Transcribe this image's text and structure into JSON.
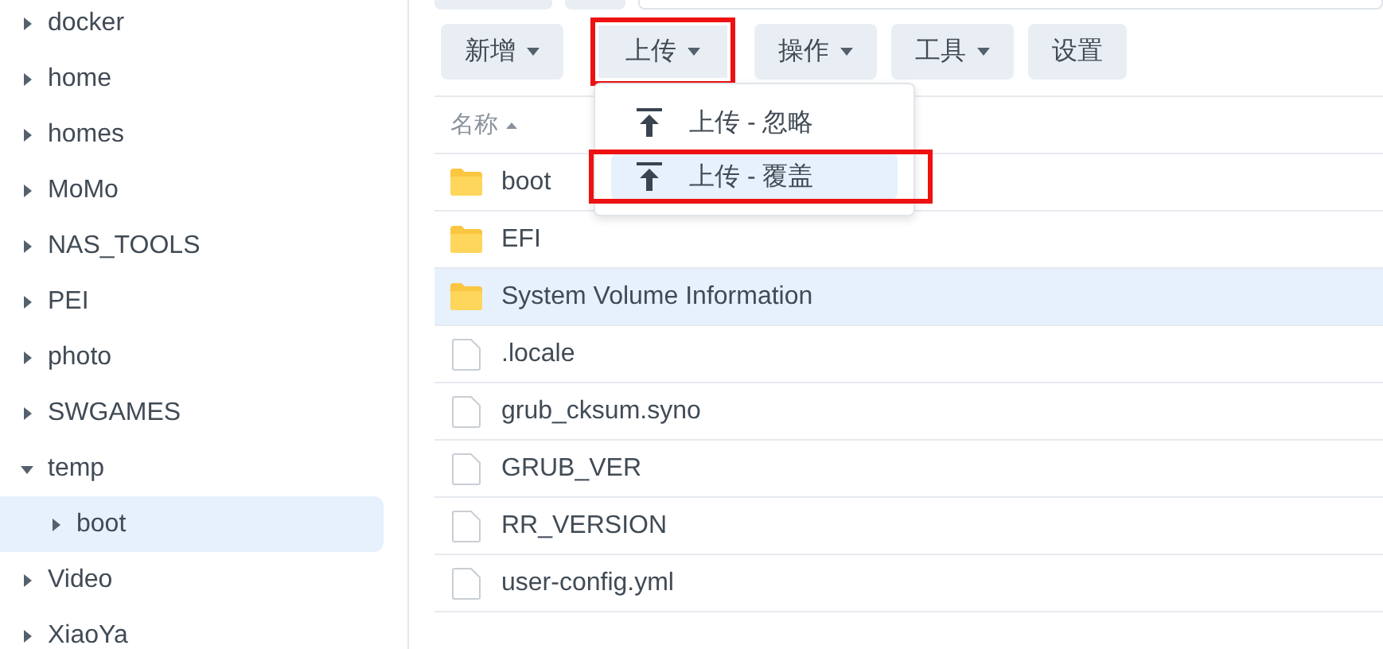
{
  "sidebar": {
    "items": [
      {
        "label": "docker",
        "expanded": false,
        "selected": false
      },
      {
        "label": "home",
        "expanded": false,
        "selected": false
      },
      {
        "label": "homes",
        "expanded": false,
        "selected": false
      },
      {
        "label": "MoMo",
        "expanded": false,
        "selected": false
      },
      {
        "label": "NAS_TOOLS",
        "expanded": false,
        "selected": false
      },
      {
        "label": "PEI",
        "expanded": false,
        "selected": false
      },
      {
        "label": "photo",
        "expanded": false,
        "selected": false
      },
      {
        "label": "SWGAMES",
        "expanded": false,
        "selected": false
      },
      {
        "label": "temp",
        "expanded": true,
        "selected": false,
        "children": [
          {
            "label": "boot",
            "expanded": false,
            "selected": true
          }
        ]
      },
      {
        "label": "Video",
        "expanded": false,
        "selected": false
      },
      {
        "label": "XiaoYa",
        "expanded": false,
        "selected": false
      }
    ]
  },
  "toolbar": {
    "buttons": [
      {
        "label": "新增",
        "dropdown": true,
        "highlighted": false
      },
      {
        "label": "上传",
        "dropdown": true,
        "highlighted": true
      },
      {
        "label": "操作",
        "dropdown": true,
        "highlighted": false
      },
      {
        "label": "工具",
        "dropdown": true,
        "highlighted": false
      },
      {
        "label": "设置",
        "dropdown": false,
        "highlighted": false
      }
    ]
  },
  "upload_menu": {
    "items": [
      {
        "label": "上传 - 忽略",
        "selected": false,
        "highlighted": false
      },
      {
        "label": "上传 - 覆盖",
        "selected": true,
        "highlighted": true
      }
    ]
  },
  "table": {
    "columns": [
      {
        "label": "名称",
        "sorted": true
      }
    ],
    "rows": [
      {
        "name": "boot",
        "kind": "folder",
        "selected": false
      },
      {
        "name": "EFI",
        "kind": "folder",
        "selected": false
      },
      {
        "name": "System Volume Information",
        "kind": "folder",
        "selected": true
      },
      {
        "name": ".locale",
        "kind": "file",
        "selected": false
      },
      {
        "name": "grub_cksum.syno",
        "kind": "file",
        "selected": false
      },
      {
        "name": "GRUB_VER",
        "kind": "file",
        "selected": false
      },
      {
        "name": "RR_VERSION",
        "kind": "file",
        "selected": false
      },
      {
        "name": "user-config.yml",
        "kind": "file",
        "selected": false
      }
    ]
  }
}
